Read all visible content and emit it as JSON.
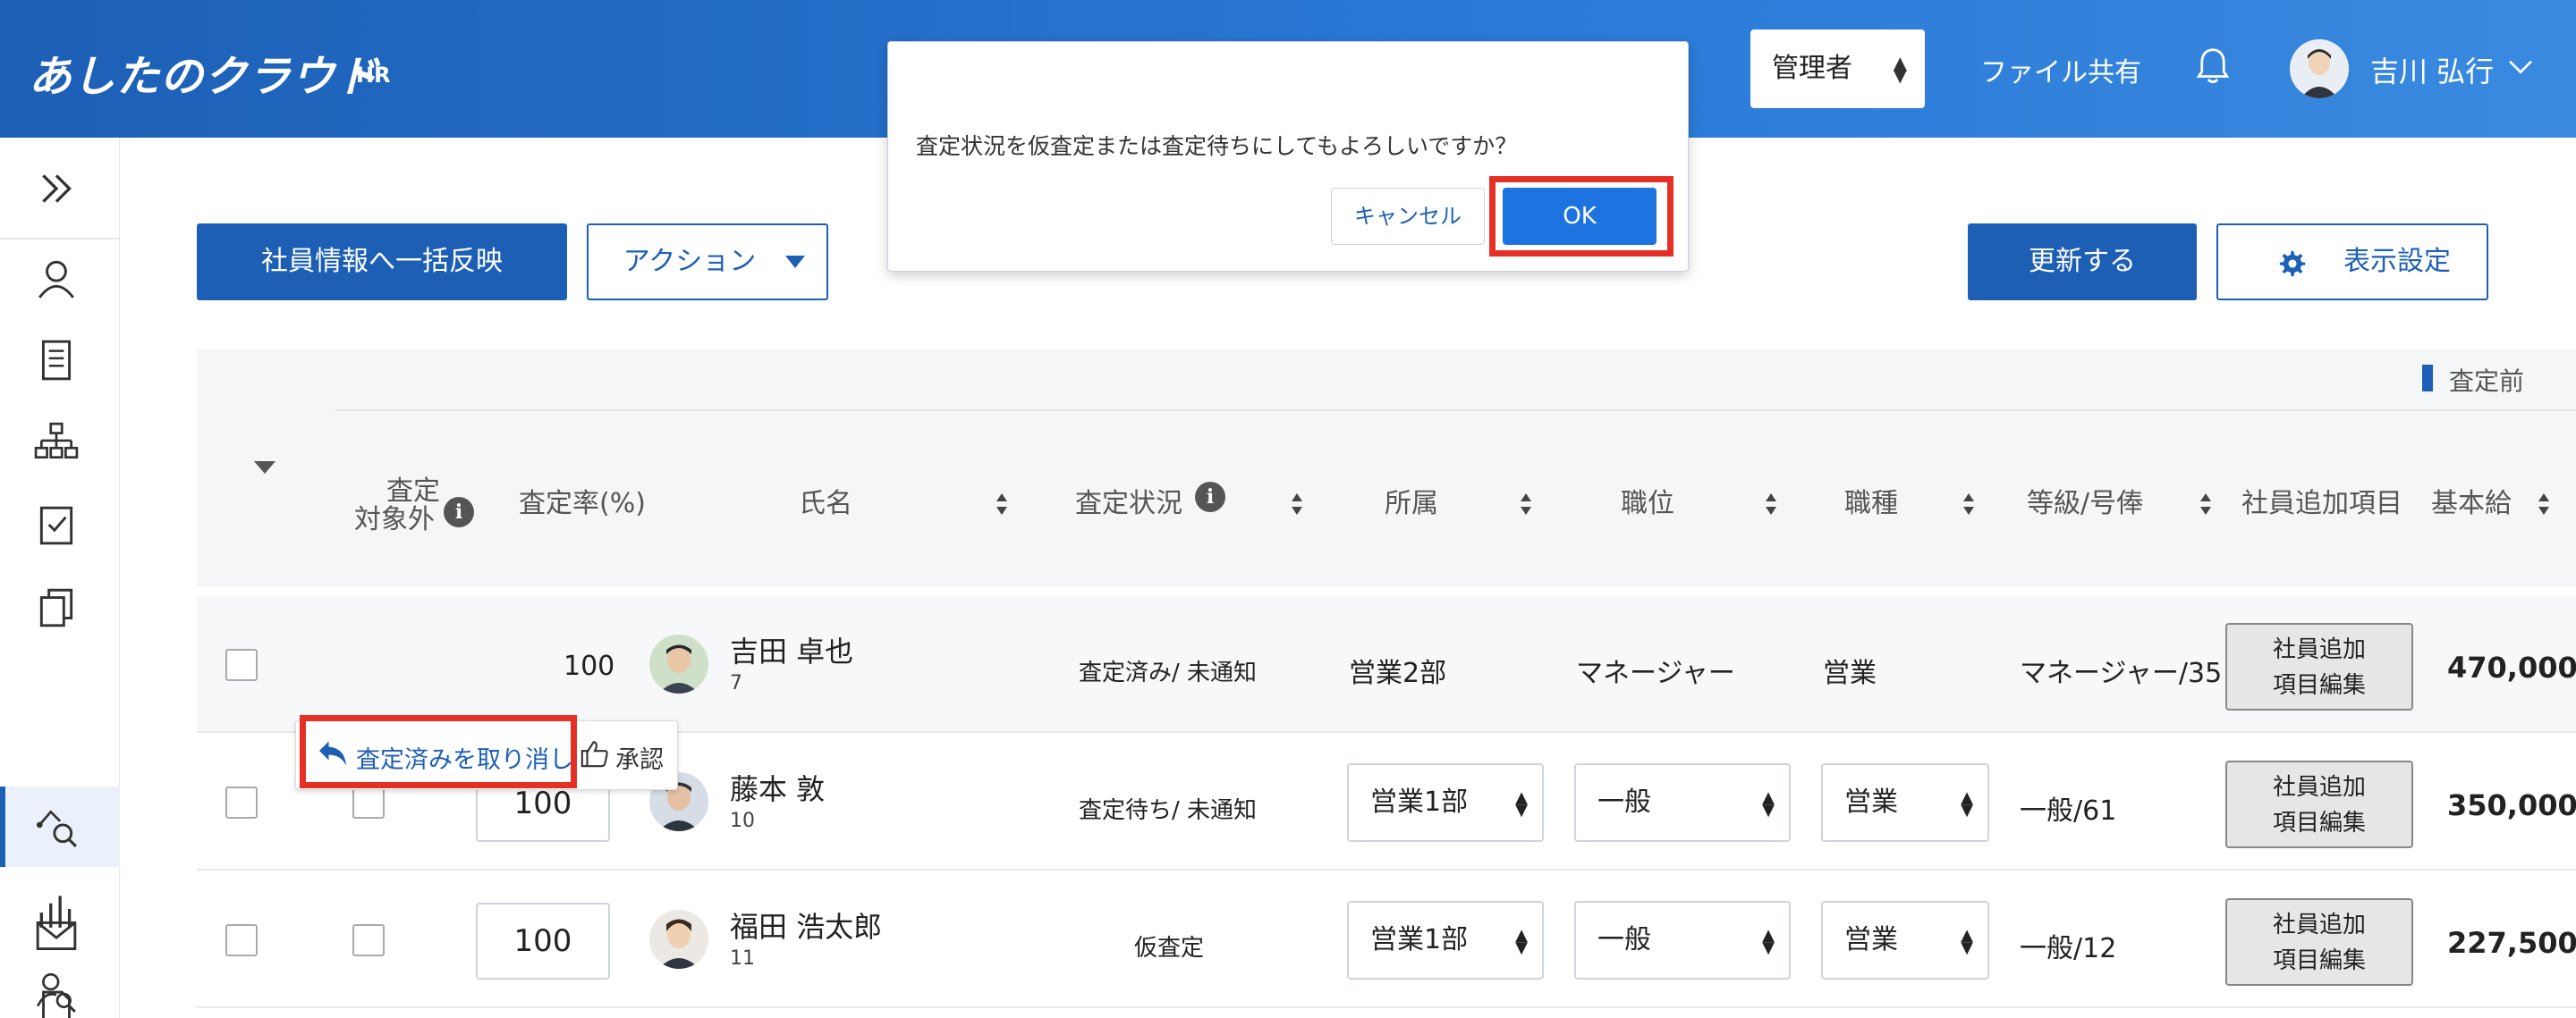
{
  "header": {
    "logo": "あしたのクラウド",
    "logo_sub": "HR",
    "role": "管理者",
    "file_share": "ファイル共有",
    "user_name": "吉川 弘行"
  },
  "toolbar": {
    "bulk_reflect": "社員情報へ一括反映",
    "action": "アクション",
    "update": "更新する",
    "display_settings": "表示設定"
  },
  "legend": {
    "label": "査定前"
  },
  "table": {
    "headers": {
      "exclude_line1": "査定",
      "exclude_line2": "対象外",
      "rate": "査定率(%)",
      "name": "氏名",
      "status": "査定状況",
      "department": "所属",
      "position": "職位",
      "job_type": "職種",
      "grade": "等級/号俸",
      "employee_extra": "社員追加項目",
      "base_salary": "基本給"
    },
    "rows": [
      {
        "rate": "100",
        "name": "吉田 卓也",
        "emp_no": "7",
        "status": "査定済み/ 未通知",
        "department": "営業2部",
        "position": "マネージャー",
        "job_type": "営業",
        "grade": "マネージャー/35",
        "edit_line1": "社員追加",
        "edit_line2": "項目編集",
        "salary": "470,000"
      },
      {
        "rate": "100",
        "name": "藤本 敦",
        "emp_no": "10",
        "status": "査定待ち/ 未通知",
        "department": "営業1部",
        "position": "一般",
        "job_type": "営業",
        "grade": "一般/61",
        "edit_line1": "社員追加",
        "edit_line2": "項目編集",
        "salary": "350,000"
      },
      {
        "rate": "100",
        "name": "福田 浩太郎",
        "emp_no": "11",
        "status": "仮査定",
        "department": "営業1部",
        "position": "一般",
        "job_type": "営業",
        "grade": "一般/12",
        "edit_line1": "社員追加",
        "edit_line2": "項目編集",
        "salary": "227,500"
      }
    ]
  },
  "popover": {
    "undo": "査定済みを取り消し",
    "approve": "承認"
  },
  "dialog": {
    "message": "査定状況を仮査定または査定待ちにしてもよろしいですか？",
    "cancel": "キャンセル",
    "ok": "OK"
  },
  "colors": {
    "header_blue": "#1d5fb5",
    "primary": "#1d5fb5",
    "ok_button": "#1d74e0",
    "highlight_red": "#e53025"
  }
}
